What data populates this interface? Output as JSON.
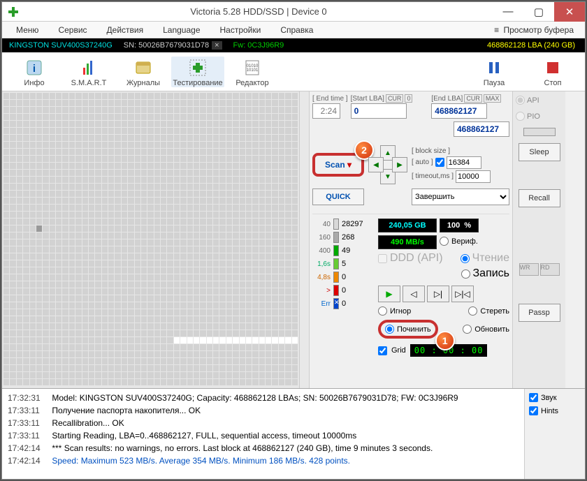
{
  "title": "Victoria 5.28 HDD/SSD | Device 0",
  "menu": {
    "items": [
      "Меню",
      "Сервис",
      "Действия",
      "Language",
      "Настройки",
      "Справка"
    ],
    "right": "Просмотр буфера"
  },
  "infobar": {
    "model": "KINGSTON SUV400S37240G",
    "sn": "SN: 50026B7679031D78",
    "fw": "Fw: 0C3J96R9",
    "lba": "468862128 LBA (240 GB)"
  },
  "toolbar": {
    "info": "Инфо",
    "smart": "S.M.A.R.T",
    "journals": "Журналы",
    "testing": "Тестирование",
    "editor": "Редактор",
    "pause": "Пауза",
    "stop": "Стоп"
  },
  "lba": {
    "end_time_label": "[ End time ]",
    "end_time_val": "2:24",
    "start_label": "[Start LBA]",
    "cur": "CUR",
    "zero": "0",
    "start_val": "0",
    "end_label": "[End LBA]",
    "max": "MAX",
    "end_val": "468862127",
    "second_val": "468862127",
    "scan": "Scan",
    "scan_arrow": "▾",
    "bs_label": "[ block size ]",
    "auto_label": "[ auto ]",
    "bs_val": "16384",
    "to_label": "[ timeout,ms ]",
    "to_val": "10000",
    "quick": "QUICK",
    "finish": "Завершить"
  },
  "stats": {
    "r40": "40",
    "r40v": "28297",
    "r160": "160",
    "r160v": "268",
    "r400": "400",
    "r400v": "49",
    "r16": "1,6s",
    "r16v": "5",
    "r48": "4,8s",
    "r48v": "0",
    "gt": ">",
    "gtv": "0",
    "err": "Err",
    "errv": "0",
    "cap": "240,05 GB",
    "pct": "100",
    "pct_unit": "%",
    "speed": "490 MB/s",
    "ddd": "DDD (API)",
    "verify": "Вериф.",
    "read": "Чтение",
    "write": "Запись",
    "ignore": "Игнор",
    "erase": "Стереть",
    "fix": "Починить",
    "refresh": "Обновить",
    "grid": "Grid",
    "lcd": "00 : 00 : 00"
  },
  "side": {
    "api": "API",
    "pio": "PIO",
    "sleep": "Sleep",
    "recall": "Recall",
    "passp": "Passp",
    "wr": "WR",
    "rd": "RD"
  },
  "log": {
    "l1t": "17:32:31",
    "l1": "Model: KINGSTON SUV400S37240G; Capacity: 468862128 LBAs; SN: 50026B7679031D78; FW: 0C3J96R9",
    "l2t": "17:33:11",
    "l2": "Получение паспорта накопителя... OK",
    "l3t": "17:33:11",
    "l3": "Recallibration... OK",
    "l4t": "17:33:11",
    "l4": "Starting Reading, LBA=0..468862127, FULL, sequential access, timeout 10000ms",
    "l5t": "17:42:14",
    "l5": "*** Scan results: no warnings, no errors. Last block at 468862127 (240 GB), time 9 minutes 3 seconds.",
    "l6t": "17:42:14",
    "l6": "Speed: Maximum 523 MB/s. Average 354 MB/s. Minimum 186 MB/s. 428 points.",
    "sound": "Звук",
    "hints": "Hints"
  },
  "markers": {
    "m1": "1",
    "m2": "2"
  }
}
